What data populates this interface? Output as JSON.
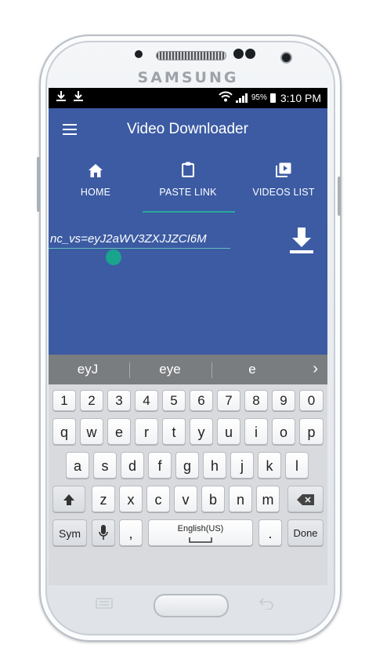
{
  "device": {
    "brand": "SAMSUNG"
  },
  "status_bar": {
    "battery_percent": "95%",
    "time": "3:10 PM"
  },
  "app_bar": {
    "title": "Video Downloader"
  },
  "tabs": [
    {
      "label": "HOME",
      "icon": "home-icon"
    },
    {
      "label": "PASTE LINK",
      "icon": "clipboard-icon",
      "selected": true
    },
    {
      "label": "VIDEOS LIST",
      "icon": "video-library-icon"
    }
  ],
  "url_input": {
    "value": "nc_vs=eyJ2aWV3ZXJJZCI6M"
  },
  "keyboard": {
    "suggestions": [
      "eyJ",
      "eye",
      "e"
    ],
    "number_row": [
      "1",
      "2",
      "3",
      "4",
      "5",
      "6",
      "7",
      "8",
      "9",
      "0"
    ],
    "row1": [
      "q",
      "w",
      "e",
      "r",
      "t",
      "y",
      "u",
      "i",
      "o",
      "p"
    ],
    "row2": [
      "a",
      "s",
      "d",
      "f",
      "g",
      "h",
      "j",
      "k",
      "l"
    ],
    "row3": [
      "z",
      "x",
      "c",
      "v",
      "b",
      "n",
      "m"
    ],
    "sym_label": "Sym",
    "comma_label": ",",
    "space_label": "English(US)",
    "period_label": ".",
    "done_label": "Done"
  },
  "colors": {
    "app_blue": "#3c5ba3",
    "accent_teal": "#29a89c"
  }
}
